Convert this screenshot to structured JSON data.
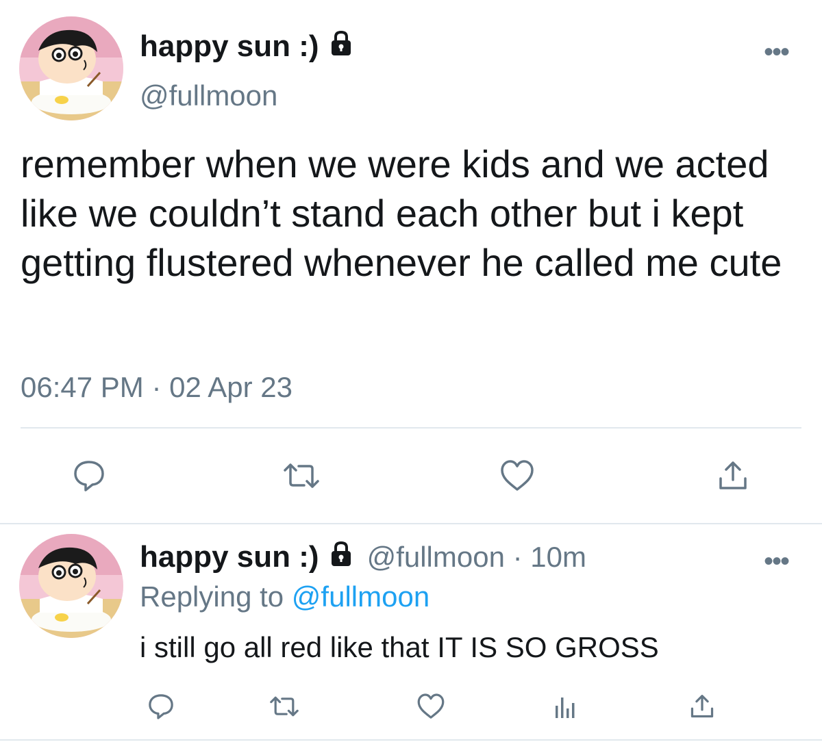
{
  "tweet": {
    "display_name": "happy sun :)",
    "handle": "@fullmoon",
    "text": "remember when we were kids and we acted like we couldn’t stand each other but i kept getting flustered whenever he called me cute",
    "time": "06:47 PM",
    "date": "02 Apr 23",
    "actions": [
      "reply-icon",
      "retweet-icon",
      "like-icon",
      "share-icon"
    ]
  },
  "reply": {
    "display_name": "happy sun :)",
    "handle": "@fullmoon",
    "age": "10m",
    "replying_prefix": "Replying to",
    "replying_to": "@fullmoon",
    "text": "i still go all red like that IT IS SO GROSS",
    "actions": [
      "reply-icon",
      "retweet-icon",
      "like-icon",
      "analytics-icon",
      "share-icon"
    ]
  },
  "separator_dot": "·",
  "more_glyph": "•••",
  "colors": {
    "text": "#14171a",
    "muted": "#657786",
    "link": "#1da1f2",
    "divider": "#e1e8ed"
  }
}
